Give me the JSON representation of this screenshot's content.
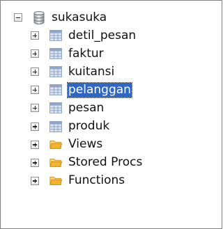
{
  "tree": {
    "root": {
      "label": "sukasuka",
      "expanded": true,
      "icon": "database-icon"
    },
    "children": [
      {
        "label": "detil_pesan",
        "icon": "table-icon",
        "expanded": false,
        "selected": false
      },
      {
        "label": "faktur",
        "icon": "table-icon",
        "expanded": false,
        "selected": false
      },
      {
        "label": "kuitansi",
        "icon": "table-icon",
        "expanded": false,
        "selected": false
      },
      {
        "label": "pelanggan",
        "icon": "table-icon",
        "expanded": false,
        "selected": true
      },
      {
        "label": "pesan",
        "icon": "table-icon",
        "expanded": false,
        "selected": false
      },
      {
        "label": "produk",
        "icon": "table-icon",
        "expanded": false,
        "selected": false
      },
      {
        "label": "Views",
        "icon": "folder-icon",
        "expanded": false,
        "selected": false
      },
      {
        "label": "Stored Procs",
        "icon": "folder-icon",
        "expanded": false,
        "selected": false
      },
      {
        "label": "Functions",
        "icon": "folder-icon",
        "expanded": false,
        "selected": false
      }
    ]
  },
  "colors": {
    "selection": "#3167c4",
    "table_icon": "#8fa6c8",
    "folder_icon": "#f2b431",
    "border": "#808080"
  }
}
